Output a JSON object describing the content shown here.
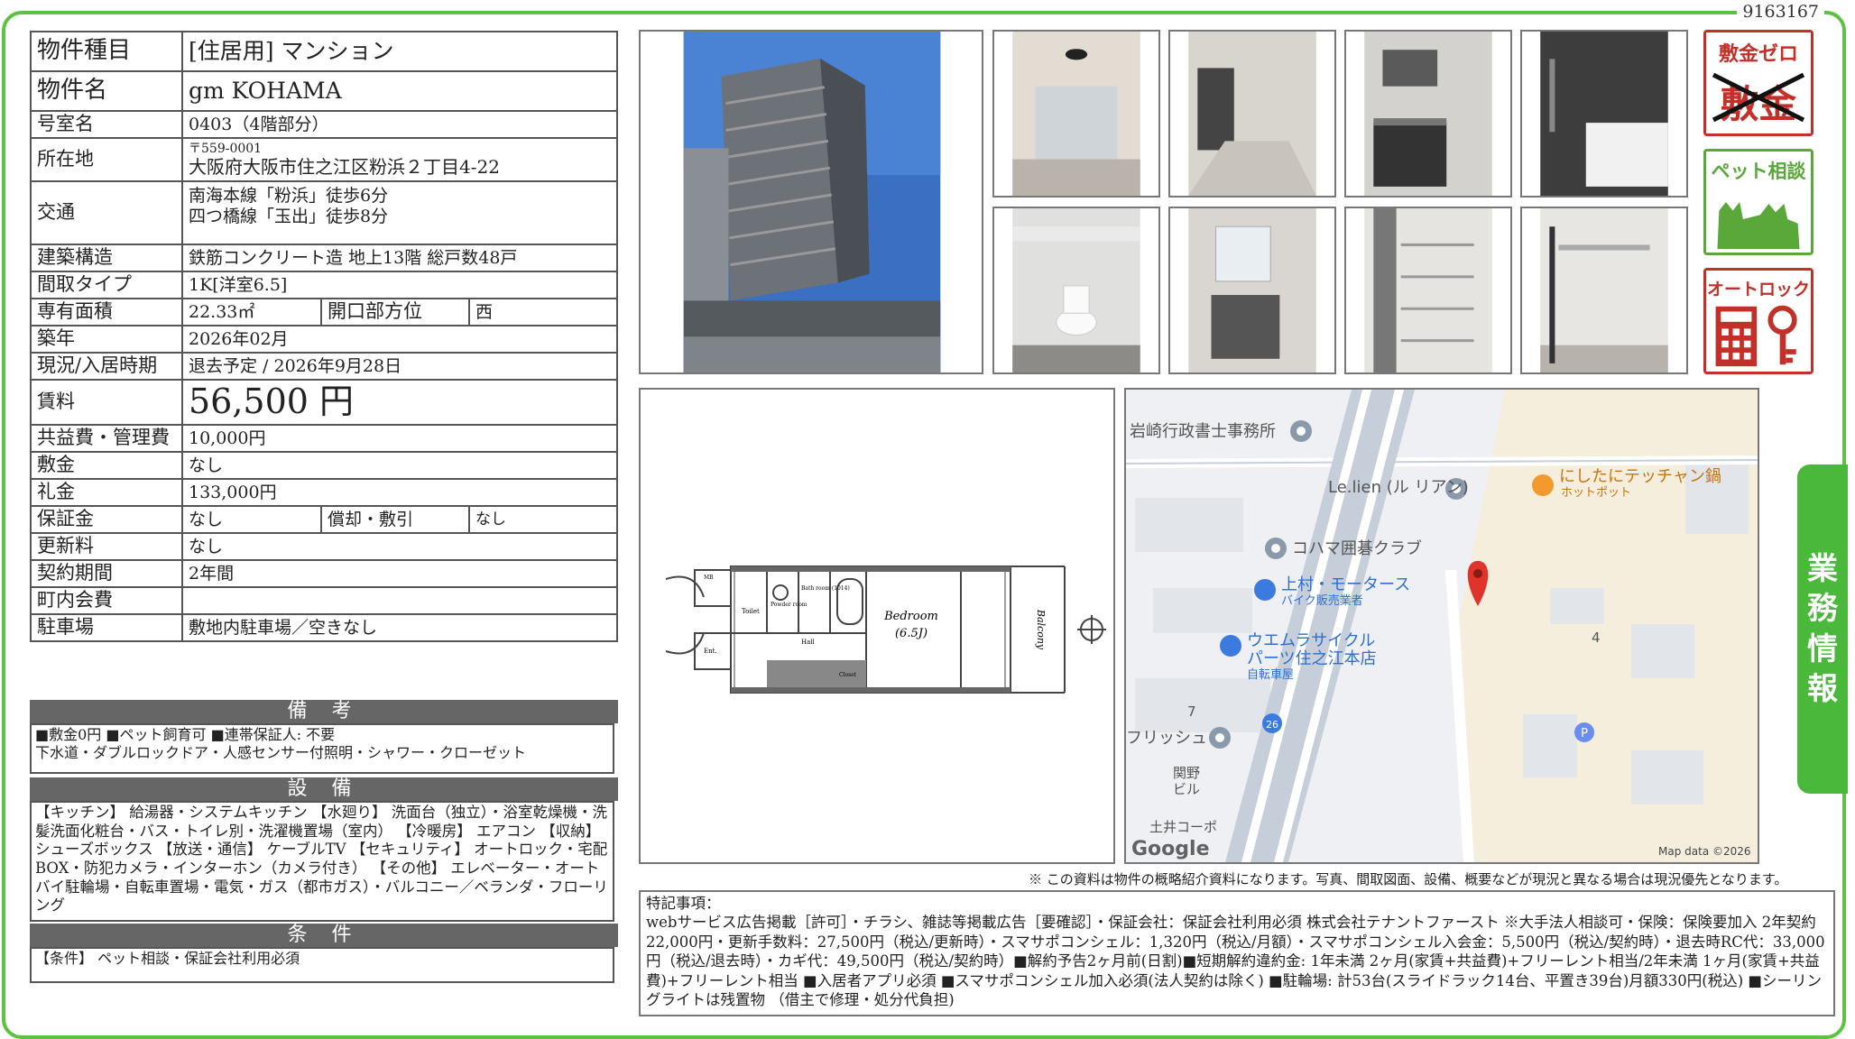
{
  "doc_id": "9163167",
  "side_tab": [
    "業",
    "務",
    "情",
    "報"
  ],
  "spec": {
    "type_label": "物件種目",
    "type_value": "[住居用] マンション",
    "name_label": "物件名",
    "name_value": "gm KOHAMA",
    "room_label": "号室名",
    "room_value": "0403（4階部分）",
    "address_label": "所在地",
    "postal": "〒559-0001",
    "address": "大阪府大阪市住之江区粉浜２丁目4-22",
    "access_label": "交通",
    "access1": "南海本線「粉浜」徒歩6分",
    "access2": "四つ橋線「玉出」徒歩8分",
    "structure_label": "建築構造",
    "structure_value": "鉄筋コンクリート造 地上13階 総戸数48戸",
    "layout_label": "間取タイプ",
    "layout_value": "1K[洋室6.5]",
    "area_label": "専有面積",
    "area_value": "22.33㎡",
    "direction_label": "開口部方位",
    "direction_value": "西",
    "built_label": "築年",
    "built_value": "2026年02月",
    "status_label": "現況/入居時期",
    "status_value": "退去予定 / 2026年9月28日",
    "rent_label": "賃料",
    "rent_value": "56,500 円",
    "fee_label": "共益費・管理費",
    "fee_value": "10,000円",
    "deposit_label": "敷金",
    "deposit_value": "なし",
    "key_money_label": "礼金",
    "key_money_value": "133,000円",
    "guarantee_label": "保証金",
    "guarantee_value": "なし",
    "amort_label": "償却・敷引",
    "amort_value": "なし",
    "renewal_label": "更新料",
    "renewal_value": "なし",
    "contract_label": "契約期間",
    "contract_value": "2年間",
    "town_label": "町内会費",
    "town_value": "",
    "parking_label": "駐車場",
    "parking_value": "敷地内駐車場／空きなし"
  },
  "remarks": {
    "title": "備 考",
    "line1": "■敷金0円 ■ペット飼育可 ■連帯保証人: 不要",
    "line2": "下水道・ダブルロックドア・人感センサー付照明・シャワー・クローゼット"
  },
  "facilities": {
    "title": "設 備",
    "text": "【キッチン】 給湯器・システムキッチン 【水廻り】 洗面台（独立）・浴室乾燥機・洗髪洗面化粧台・バス・トイレ別・洗濯機置場（室内） 【冷暖房】 エアコン 【収納】 シューズボックス 【放送・通信】 ケーブルTV 【セキュリティ】 オートロック・宅配BOX・防犯カメラ・インターホン（カメラ付き） 【その他】 エレベーター・オートバイ駐輪場・自転車置場・電気・ガス（都市ガス）・バルコニー／ベランダ・フローリング"
  },
  "conditions": {
    "title": "条 件",
    "text": "【条件】 ペット相談・保証会社利用必須"
  },
  "badges": {
    "zero_title": "敷金ゼロ",
    "zero_crossed": "敷金",
    "pet_title": "ペット相談",
    "lock_title": "オートロック"
  },
  "floorplan": {
    "bedroom": "Bedroom",
    "bedroom_size": "(6.5J)",
    "balcony": "Balcony",
    "toilet": "Toilet",
    "powder": "Powder room",
    "bath": "Bath room (1014)",
    "hall": "Hall",
    "ent": "Ent.",
    "mb": "MB",
    "closet": "Closet"
  },
  "map": {
    "poi1": "岩崎行政書士事務所",
    "poi2": "Le.lien (ル リアン)",
    "poi3": "にしたにテッチャン鍋",
    "poi3_sub": "ホットポット",
    "poi4": "コハマ囲碁クラブ",
    "poi5": "上村・モータース",
    "poi5_sub": "バイク販売業者",
    "poi6": "ウエムラサイクル",
    "poi6_line2": "パーツ住之江本店",
    "poi6_sub": "自転車屋",
    "poi7": "フリッシュ",
    "poi8": "関野",
    "poi8_line2": "ビル",
    "poi9": "土井コーポ",
    "num7": "7",
    "num4": "4",
    "route": "26",
    "parking": "P",
    "logo": "Google",
    "credit": "Map data ©2026"
  },
  "note": "※ この資料は物件の概略紹介資料になります。写真、間取図面、設備、概要などが現況と異なる場合は現況優先となります。",
  "special": {
    "title": "特記事項：",
    "text": "webサービス広告掲載［許可］・チラシ、雑誌等掲載広告［要確認］・保証会社：保証会社利用必須 株式会社テナントファースト ※大手法人相談可・保険：保険要加入 2年契約 22,000円・更新手数料：27,500円（税込/更新時）・スマサポコンシェル：1,320円（税込/月額）・スマサポコンシェル入会金：5,500円（税込/契約時）・退去時RC代：33,000円（税込/退去時）・カギ代：49,500円（税込/契約時）■解約予告2ヶ月前(日割)■短期解約違約金: 1年未満 2ヶ月(家賃+共益費)+フリーレント相当/2年未満 1ヶ月(家賃+共益費)+フリーレント相当 ■入居者アプリ必須 ■スマサポコンシェル加入必須(法人契約は除く) ■駐輪場: 計53台(スライドラック14台、平置き39台)月額330円(税込) ■シーリングライトは残置物 （借主で修理・処分代負担)"
  }
}
